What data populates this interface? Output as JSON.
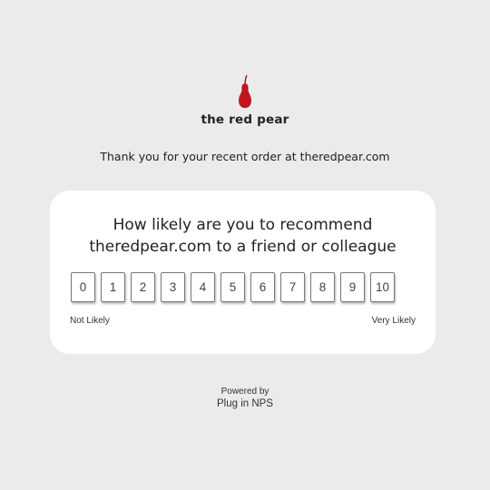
{
  "brand": {
    "name": "the red pear",
    "logo_icon": "pear-icon",
    "color": "#c0161c"
  },
  "intro": "Thank you for your recent order at theredpear.com",
  "survey": {
    "question_line1": "How likely are you to recommend",
    "question_line2": "theredpear.com to a friend or colleague",
    "scores": [
      "0",
      "1",
      "2",
      "3",
      "4",
      "5",
      "6",
      "7",
      "8",
      "9",
      "10"
    ],
    "low_label": "Not Likely",
    "high_label": "Very Likely"
  },
  "footer": {
    "powered_by": "Powered by",
    "provider": "Plug in NPS"
  }
}
